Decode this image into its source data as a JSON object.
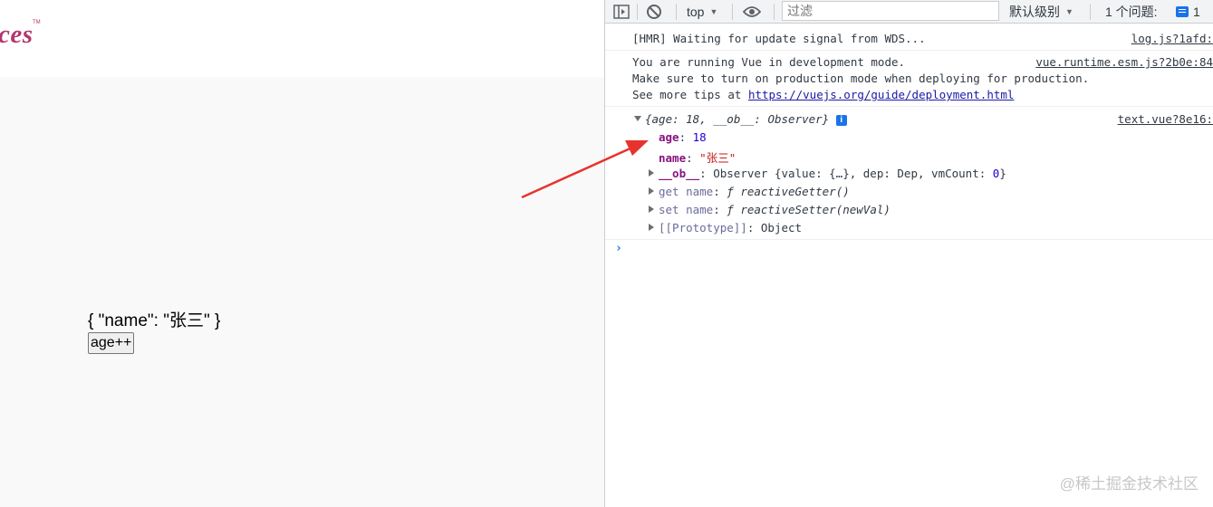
{
  "page": {
    "logo_text": "ces",
    "logo_tm": "TM",
    "json_output": "{ \"name\": \"张三\" }",
    "button_label": "age++"
  },
  "devtools": {
    "toolbar": {
      "context": "top",
      "filter_placeholder": "过滤",
      "level": "默认级别",
      "issues_label": "1 个问题:",
      "issues_count": "1"
    },
    "messages": {
      "hmr": {
        "text": "[HMR] Waiting for update signal from WDS...",
        "source": "log.js?1afd:"
      },
      "vue": {
        "line1": "You are running Vue in development mode.",
        "line2": "Make sure to turn on production mode when deploying for production.",
        "line3_prefix": "See more tips at ",
        "link": "https://vuejs.org/guide/deployment.html",
        "source": "vue.runtime.esm.js?2b0e:84"
      },
      "object": {
        "summary": "{age: 18, __ob__: Observer}",
        "info_icon": "i",
        "source": "text.vue?8e16:",
        "props": {
          "age_key": "age",
          "age_value": "18",
          "name_key": "name",
          "name_value": "\"张三\"",
          "ob_key": "__ob__",
          "ob_value": "Observer {value: {…}, dep: Dep, vmCount: ",
          "ob_vmcount": "0",
          "ob_close": "}",
          "getter_key": "get name",
          "getter_value": "ƒ reactiveGetter()",
          "setter_key": "set name",
          "setter_value": "ƒ reactiveSetter(newVal)",
          "proto_key": "[[Prototype]]",
          "proto_value": "Object"
        }
      }
    },
    "prompt_symbol": "›"
  },
  "watermark": "@稀土掘金技术社区",
  "colors": {
    "logo": "#b2366d",
    "arrow": "#e8322d",
    "property_key": "#881280",
    "string_value": "#c41a16",
    "number_value": "#1c00cf",
    "link": "#1a1aa6",
    "accent_blue": "#1a73e8"
  },
  "icons": [
    "sidebar-toggle-icon",
    "clear-console-icon",
    "eye-icon",
    "issues-icon",
    "info-icon",
    "expand-triangle-icon",
    "prompt-chevron-icon"
  ]
}
